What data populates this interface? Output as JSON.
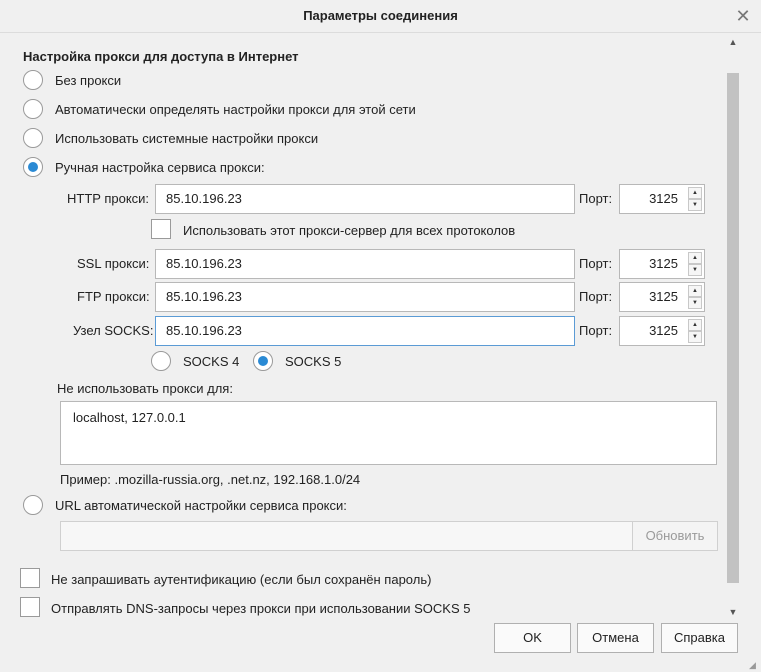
{
  "window": {
    "title": "Параметры соединения",
    "close_icon": "close-icon"
  },
  "section": {
    "title": "Настройка прокси для доступа в Интернет"
  },
  "proxy_modes": {
    "no_proxy": "Без прокси",
    "auto_detect": "Автоматически определять настройки прокси для этой сети",
    "system": "Использовать системные настройки прокси",
    "manual": "Ручная настройка сервиса прокси:",
    "selected": "manual"
  },
  "manual": {
    "http_label": "HTTP прокси:",
    "http_value": "85.10.196.23",
    "port_label": "Порт:",
    "http_port": "3125",
    "share_all_label": "Использовать этот прокси-сервер для всех протоколов",
    "share_all_checked": false,
    "ssl_label": "SSL прокси:",
    "ssl_value": "85.10.196.23",
    "ssl_port": "3125",
    "ftp_label": "FTP прокси:",
    "ftp_value": "85.10.196.23",
    "ftp_port": "3125",
    "socks_label": "Узел SOCKS:",
    "socks_value": "85.10.196.23",
    "socks_port": "3125",
    "socks4_label": "SOCKS 4",
    "socks5_label": "SOCKS 5",
    "socks_version": "5"
  },
  "no_proxy_for": {
    "label": "Не использовать прокси для:",
    "value": "localhost, 127.0.0.1",
    "example": "Пример: .mozilla-russia.org, .net.nz, 192.168.1.0/24"
  },
  "auto_config": {
    "label": "URL автоматической настройки сервиса прокси:",
    "url_value": "",
    "reload_label": "Обновить"
  },
  "options": {
    "no_auth_prompt": "Не запрашивать аутентификацию (если был сохранён пароль)",
    "no_auth_prompt_checked": false,
    "socks_dns": "Отправлять DNS-запросы через прокси при использовании SOCKS 5",
    "socks_dns_checked": false
  },
  "buttons": {
    "ok": "OK",
    "cancel": "Отмена",
    "help": "Справка"
  },
  "colors": {
    "accent": "#2a8ad4",
    "focus_border": "#5b9bd5"
  }
}
